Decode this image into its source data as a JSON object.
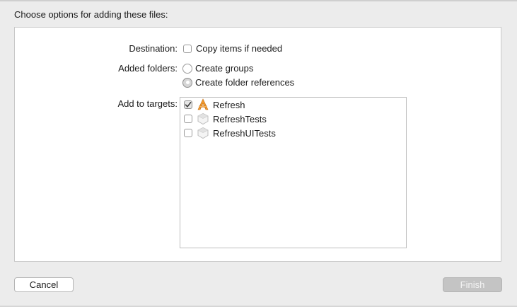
{
  "header": {
    "title": "Choose options for adding these files:"
  },
  "destination": {
    "label": "Destination:",
    "copy_items": {
      "label": "Copy items if needed",
      "checked": false
    }
  },
  "added_folders": {
    "label": "Added folders:",
    "options": [
      {
        "label": "Create groups",
        "selected": false
      },
      {
        "label": "Create folder references",
        "selected": true
      }
    ]
  },
  "targets": {
    "label": "Add to targets:",
    "items": [
      {
        "name": "Refresh",
        "checked": true,
        "icon": "app-target-icon"
      },
      {
        "name": "RefreshTests",
        "checked": false,
        "icon": "test-target-icon"
      },
      {
        "name": "RefreshUITests",
        "checked": false,
        "icon": "test-target-icon"
      }
    ]
  },
  "buttons": {
    "cancel": "Cancel",
    "finish": "Finish",
    "finish_enabled": false
  },
  "colors": {
    "app_icon_orange": "#f29a2e",
    "test_icon_gray": "#c9c9c9",
    "panel_background": "#ffffff",
    "sheet_background": "#ececec"
  }
}
